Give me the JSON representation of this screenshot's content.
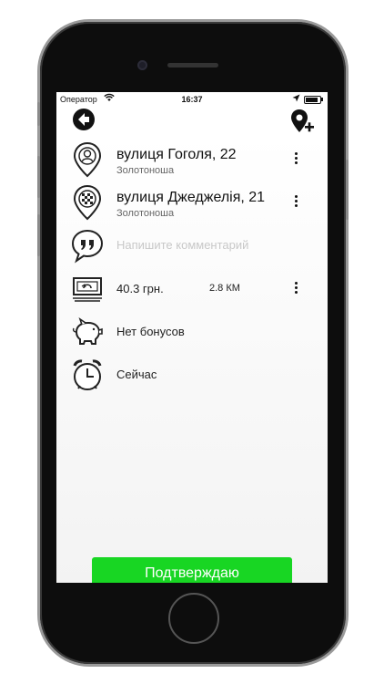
{
  "status_bar": {
    "carrier": "Оператор",
    "time": "16:37"
  },
  "route": {
    "from": {
      "street": "вулиця Гоголя, 22",
      "city": "Золотоноша"
    },
    "to": {
      "street": "вулиця Джеджелія, 21",
      "city": "Золотоноша"
    }
  },
  "comment": {
    "placeholder": "Напишите комментарий"
  },
  "price": {
    "amount": "40.3 грн.",
    "distance": "2.8 КМ"
  },
  "bonus": {
    "label": "Нет бонусов"
  },
  "time_option": {
    "label": "Сейчас"
  },
  "confirm_button": {
    "label": "Подтверждаю"
  },
  "colors": {
    "accent": "#18d623"
  },
  "icons": {
    "back": "arrow-left-icon",
    "add_point": "map-pin-plus-icon",
    "from": "start-pin-icon",
    "to": "finish-flag-pin-icon",
    "comment": "quote-bubble-icon",
    "price": "banknote-icon",
    "bonus": "piggy-bank-icon",
    "time": "alarm-clock-icon",
    "menu": "more-vertical-icon"
  }
}
